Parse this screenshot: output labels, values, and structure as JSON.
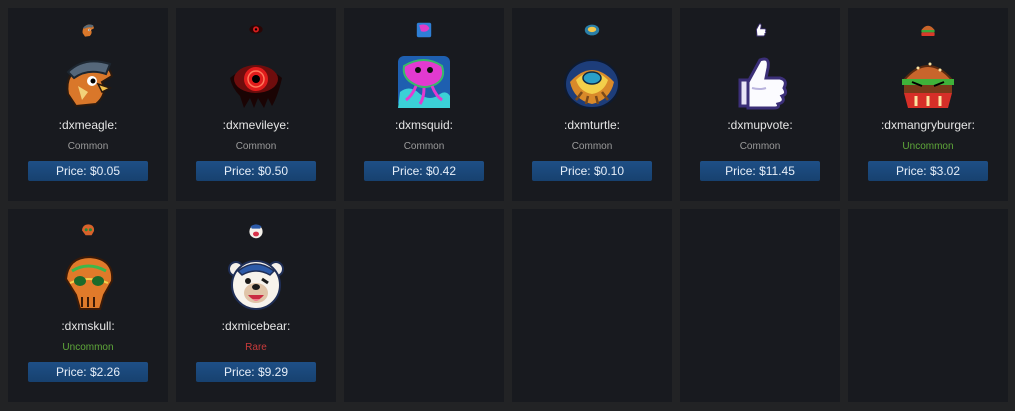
{
  "colors": {
    "common": "#9b9b9b",
    "uncommon": "#5fa83a",
    "rare": "#c93b3b",
    "button": "#1b4a7e",
    "card_bg": "#181a1f",
    "page_bg": "#222325"
  },
  "items": [
    {
      "name": ":dxmeagle:",
      "rarity": "Common",
      "rarity_key": "common",
      "price": "Price: $0.05",
      "icon": "eagle-emoticon"
    },
    {
      "name": ":dxmevileye:",
      "rarity": "Common",
      "rarity_key": "common",
      "price": "Price: $0.50",
      "icon": "evil-eye-emoticon"
    },
    {
      "name": ":dxmsquid:",
      "rarity": "Common",
      "rarity_key": "common",
      "price": "Price: $0.42",
      "icon": "squid-emoticon"
    },
    {
      "name": ":dxmturtle:",
      "rarity": "Common",
      "rarity_key": "common",
      "price": "Price: $0.10",
      "icon": "turtle-emoticon"
    },
    {
      "name": ":dxmupvote:",
      "rarity": "Common",
      "rarity_key": "common",
      "price": "Price: $11.45",
      "icon": "thumbs-up-emoticon"
    },
    {
      "name": ":dxmangryburger:",
      "rarity": "Uncommon",
      "rarity_key": "uncommon",
      "price": "Price: $3.02",
      "icon": "angry-burger-emoticon"
    },
    {
      "name": ":dxmskull:",
      "rarity": "Uncommon",
      "rarity_key": "uncommon",
      "price": "Price: $2.26",
      "icon": "skull-emoticon"
    },
    {
      "name": ":dxmicebear:",
      "rarity": "Rare",
      "rarity_key": "rare",
      "price": "Price: $9.29",
      "icon": "ice-bear-emoticon"
    }
  ]
}
